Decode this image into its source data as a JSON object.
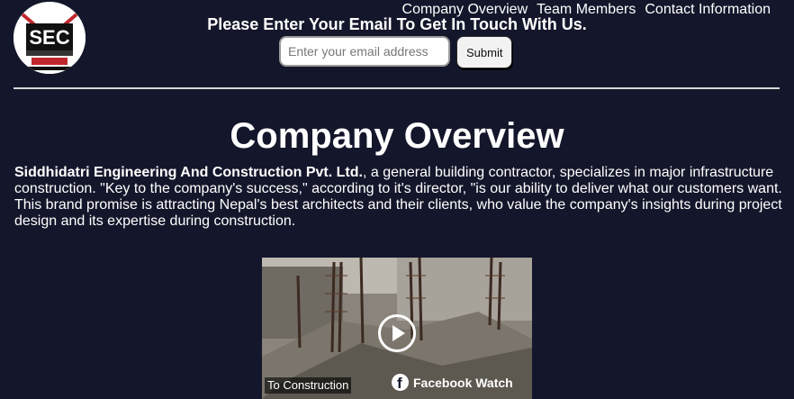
{
  "logo": {
    "text": "SEC",
    "icon": "company-logo"
  },
  "nav": {
    "items": [
      {
        "label": "Company Overview"
      },
      {
        "label": "Team Members"
      },
      {
        "label": "Contact Information"
      }
    ]
  },
  "contact": {
    "heading": "Please Enter Your Email To Get In Touch With Us.",
    "email_placeholder": "Enter your email address",
    "email_value": "",
    "submit_label": "Submit"
  },
  "overview": {
    "title": "Company Overview",
    "company_name": "Siddhidatri Engineering And Construction Pvt. Ltd.",
    "body": ", a general building contractor, specializes in major infrastructure construction. \"Key to the company's success,\" according to it's director, \"is our ability to deliver what our customers want. This brand promise is attracting Nepal's best architects and their clients, who value the company's insights during project design and its expertise during construction."
  },
  "video": {
    "caption": "To Construction",
    "provider_label": "Facebook Watch",
    "play_icon": "play-icon",
    "provider_icon": "facebook-icon"
  },
  "colors": {
    "background": "#14172b",
    "text": "#ffffff",
    "divider": "#d8d8d8"
  }
}
